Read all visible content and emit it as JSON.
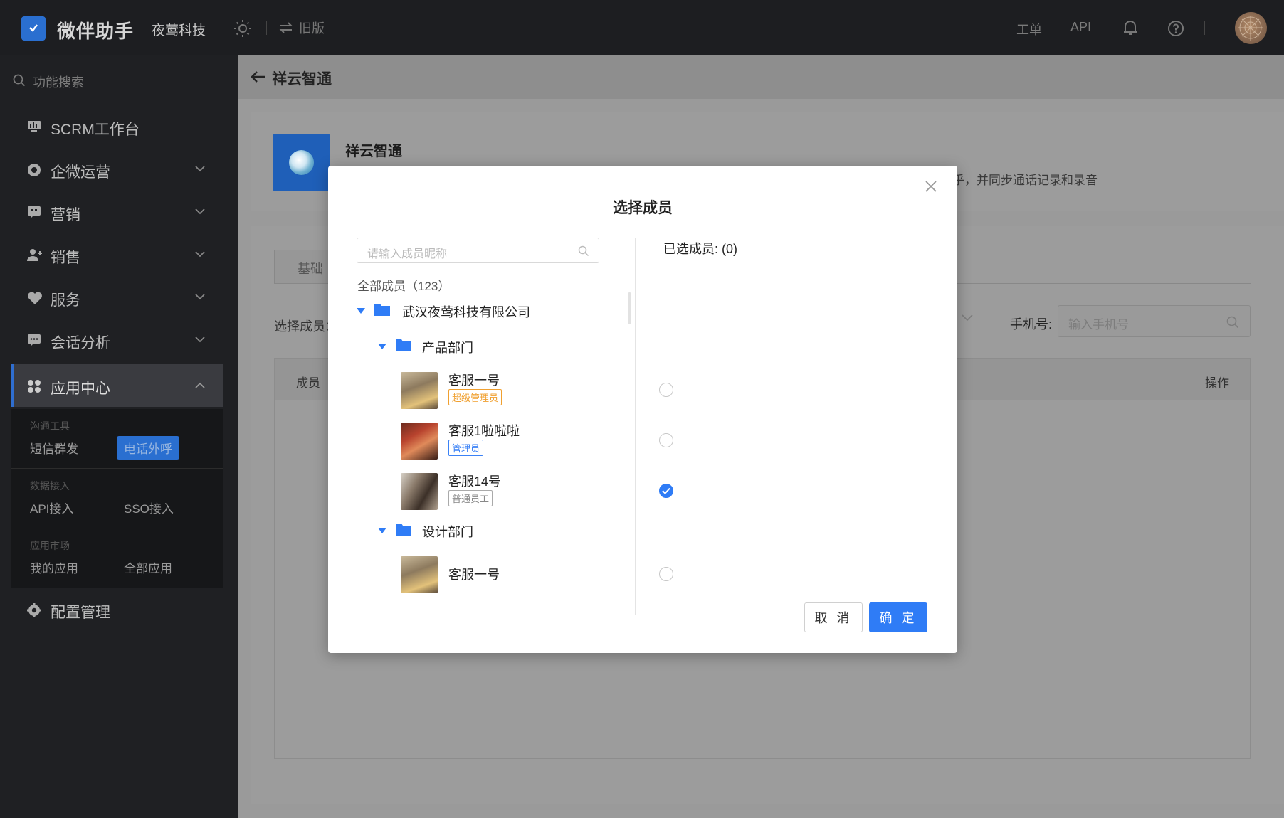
{
  "topbar": {
    "app_name": "微伴助手",
    "company": "夜莺科技",
    "switch_label": "旧版",
    "ticket_label": "工单",
    "api_label": "API"
  },
  "sidebar": {
    "search_placeholder": "功能搜索",
    "items": [
      {
        "label": "SCRM工作台",
        "icon": "dashboard-icon"
      },
      {
        "label": "企微运营",
        "icon": "operation-icon"
      },
      {
        "label": "营销",
        "icon": "marketing-icon"
      },
      {
        "label": "销售",
        "icon": "sales-icon"
      },
      {
        "label": "服务",
        "icon": "service-icon"
      },
      {
        "label": "会话分析",
        "icon": "chat-analysis-icon"
      },
      {
        "label": "应用中心",
        "icon": "app-center-icon"
      },
      {
        "label": "配置管理",
        "icon": "settings-icon"
      }
    ],
    "sub_groups": [
      {
        "title": "沟通工具",
        "links": [
          "短信群发",
          "电话外呼"
        ]
      },
      {
        "title": "数据接入",
        "links": [
          "API接入",
          "SSO接入"
        ]
      },
      {
        "title": "应用市场",
        "links": [
          "我的应用",
          "全部应用"
        ]
      }
    ],
    "selected_sub_link": "电话外呼"
  },
  "page": {
    "title": "祥云智通",
    "card_name": "祥云智通",
    "card_desc_partial": "乎，并同步通话记录和录音",
    "tab_label_partial": "基础",
    "filter_label_partial": "选择成员：",
    "phone_label": "手机号:",
    "phone_placeholder": "输入手机号",
    "table_headers": {
      "member": "成员",
      "operation": "操作"
    }
  },
  "modal": {
    "title": "选择成员",
    "search_placeholder": "请输入成员昵称",
    "all_members": "全部成员（123）",
    "company": "武汉夜莺科技有限公司",
    "departments": [
      {
        "name": "产品部门",
        "members": [
          {
            "name": "客服一号",
            "role": "超级管理员",
            "role_color": "#f0a030",
            "checked": false
          },
          {
            "name": "客服1啦啦啦",
            "role": "管理员",
            "role_color": "#3b82f6",
            "checked": false
          },
          {
            "name": "客服14号",
            "role": "普通员工",
            "role_color": "#888888",
            "checked": true
          }
        ]
      },
      {
        "name": "设计部门",
        "members": [
          {
            "name": "客服一号",
            "role": "",
            "checked": false
          }
        ]
      }
    ],
    "selected_label": "已选成员: (0)",
    "cancel_label": "取 消",
    "confirm_label": "确 定"
  },
  "colors": {
    "accent": "#2f7cf6",
    "sidebar_bg": "#1f2023",
    "topbar_bg": "#1d1e21"
  }
}
